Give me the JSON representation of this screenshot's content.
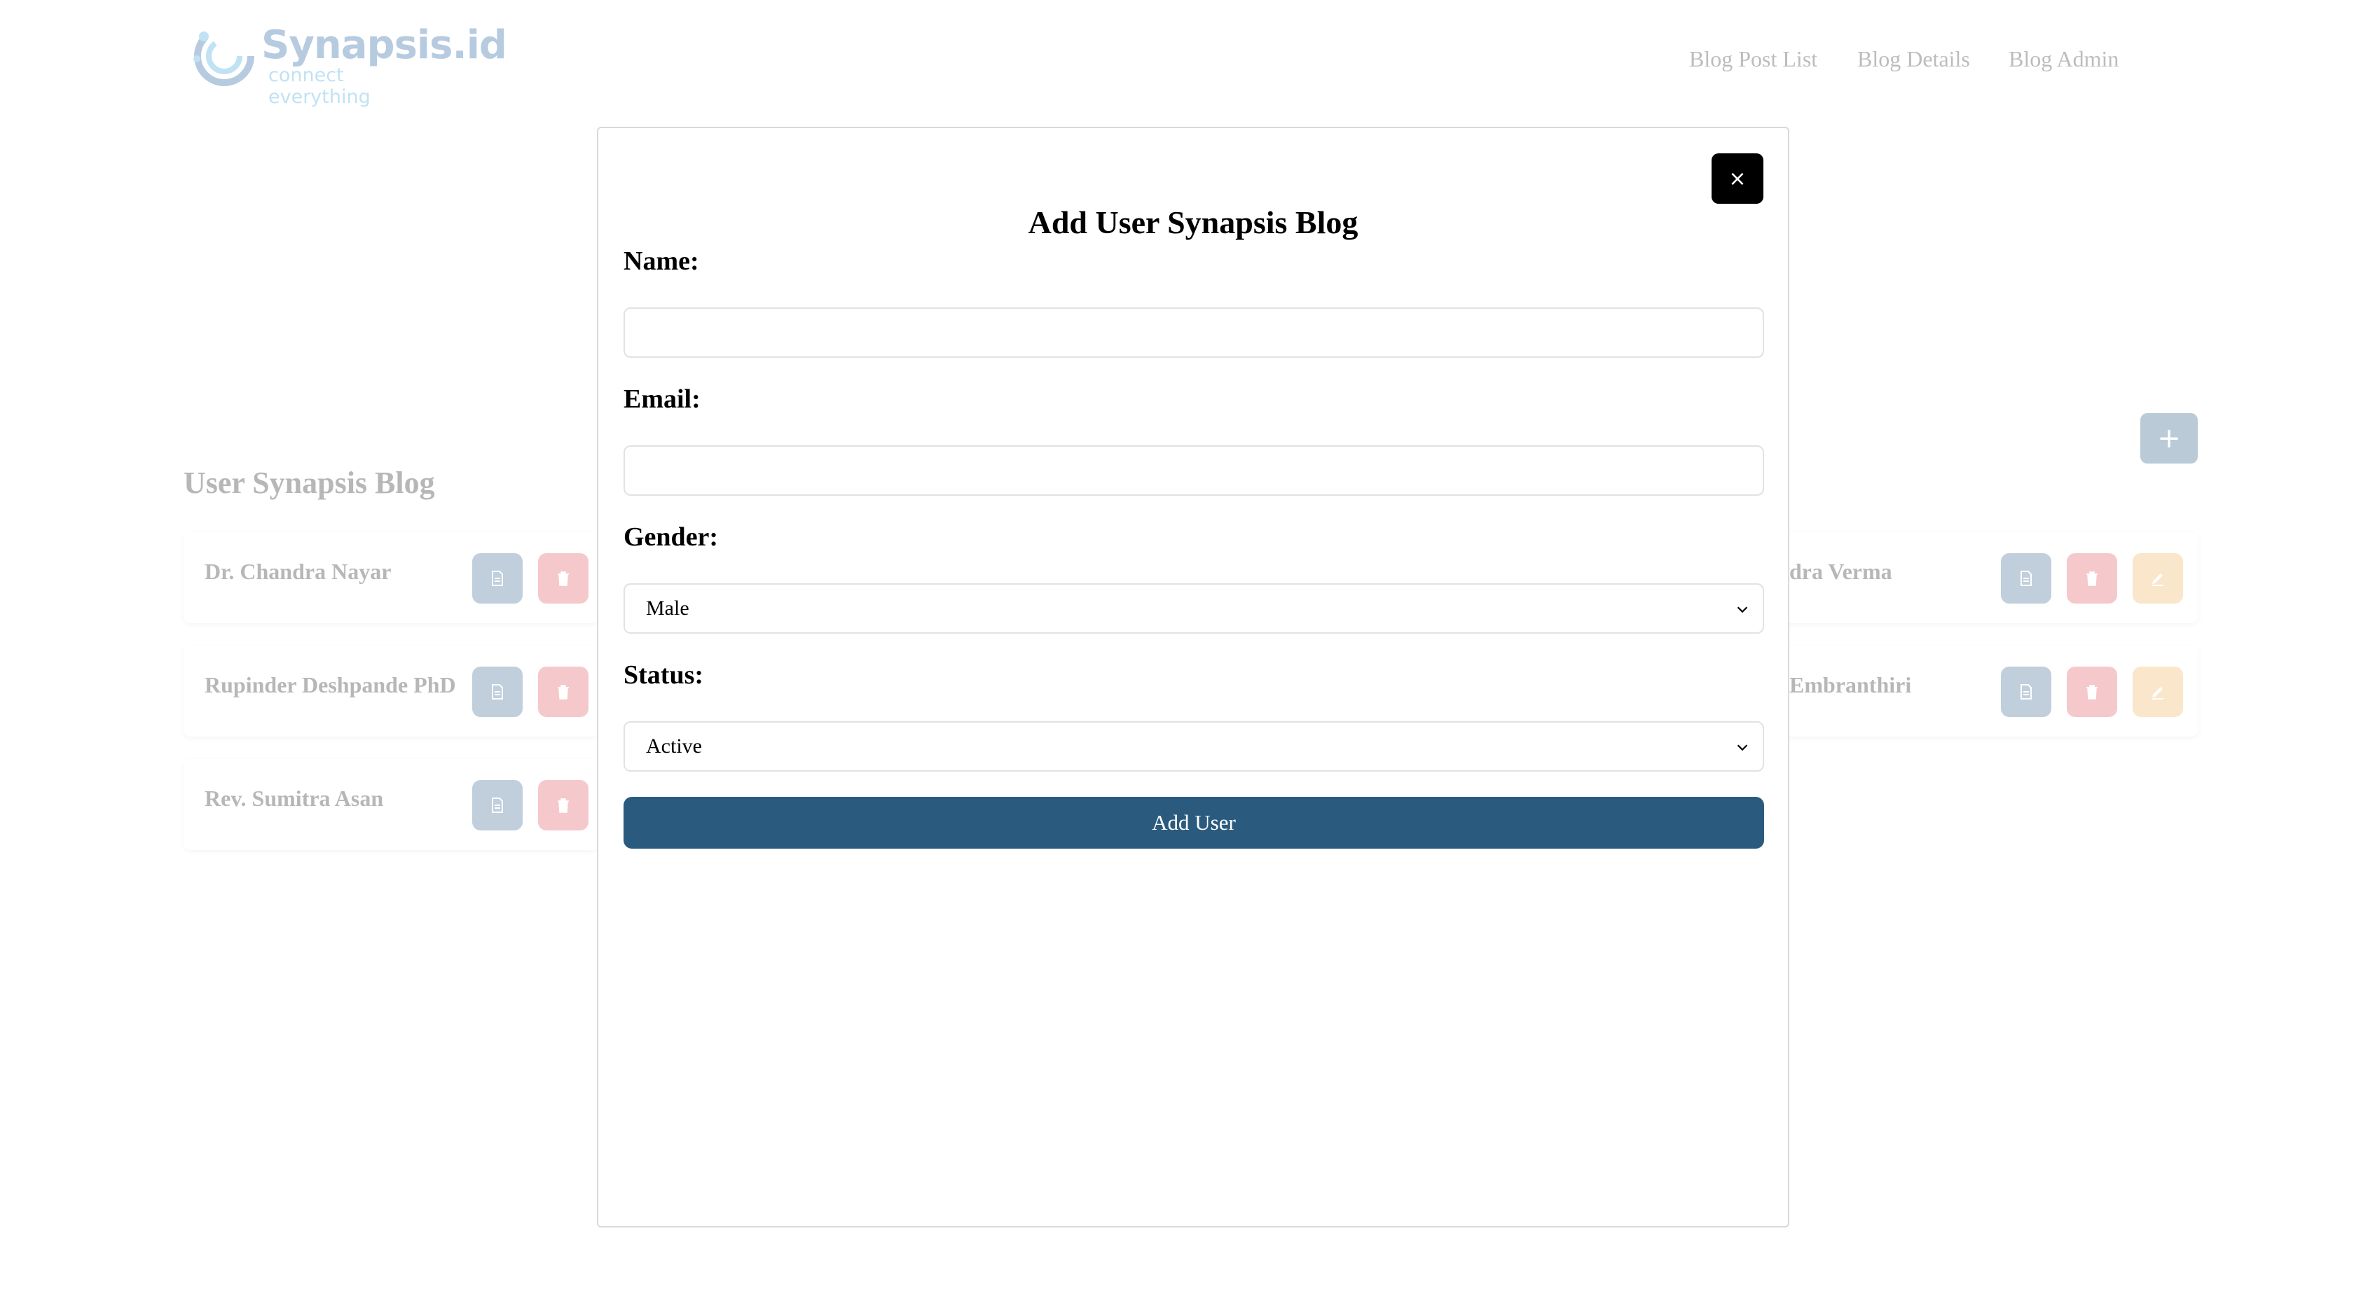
{
  "brand": {
    "name": "Synapsis.id",
    "tagline": "connect everything"
  },
  "nav": {
    "items": [
      "Blog Post List",
      "Blog Details",
      "Blog Admin"
    ]
  },
  "page": {
    "title": "User Synapsis Blog",
    "users": [
      "Dr. Chandra Nayar",
      "Rupinder Deshpande PhD",
      "Rev. Sumitra Asan",
      "dra Verma",
      "Embranthiri"
    ]
  },
  "modal": {
    "close_label": "×",
    "title": "Add User Synapsis Blog",
    "name_label": "Name:",
    "email_label": "Email:",
    "gender_label": "Gender:",
    "gender_value": "Male",
    "status_label": "Status:",
    "status_value": "Active",
    "submit_label": "Add User"
  },
  "colors": {
    "primary": "#2b5a7f",
    "danger": "#e35b62",
    "warning": "#f2b45c"
  }
}
